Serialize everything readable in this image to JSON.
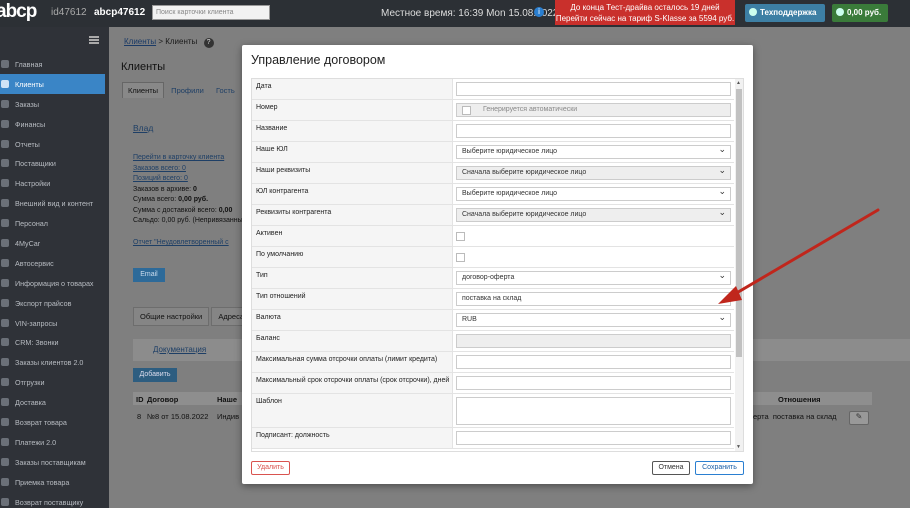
{
  "topbar": {
    "logo": "abcp",
    "account_id": "id47612",
    "account_login": "abcp47612",
    "search_placeholder": "Поиск карточки клиента",
    "local_time": "Местное время: 16:39 Mon 15.08.2022",
    "alert_line1": "До конца Тест-драйва осталось 19 дней",
    "alert_line2": "Перейти сейчас на тариф S-Klasse за 5594 руб.",
    "support_label": "Техподдержка",
    "balance_label": "0,00 руб."
  },
  "sidebar": {
    "items": [
      {
        "label": "Главная"
      },
      {
        "label": "Клиенты"
      },
      {
        "label": "Заказы"
      },
      {
        "label": "Финансы"
      },
      {
        "label": "Отчеты"
      },
      {
        "label": "Поставщики"
      },
      {
        "label": "Настройки"
      },
      {
        "label": "Внешний вид и контент"
      },
      {
        "label": "Персонал"
      },
      {
        "label": "4MyCar"
      },
      {
        "label": "Автосервис"
      },
      {
        "label": "Информация о товарах"
      },
      {
        "label": "Экспорт прайсов"
      },
      {
        "label": "VIN-запросы"
      },
      {
        "label": "CRM: Звонки"
      },
      {
        "label": "Заказы клиентов 2.0"
      },
      {
        "label": "Отгрузки"
      },
      {
        "label": "Доставка"
      },
      {
        "label": "Возврат товара"
      },
      {
        "label": "Платежи 2.0"
      },
      {
        "label": "Заказы поставщикам"
      },
      {
        "label": "Приемка товара"
      },
      {
        "label": "Возврат поставщику"
      }
    ],
    "active_index": 1
  },
  "page": {
    "breadcrumb_link": "Клиенты",
    "breadcrumb_sep": ">",
    "breadcrumb_current": "Клиенты",
    "title": "Клиенты",
    "tabs": [
      "Клиенты",
      "Профили",
      "Гость"
    ],
    "client_name": "Влад",
    "client_card_link": "Перейти в карточку клиента",
    "orders_total": "Заказов всего: 0",
    "positions_total": "Позиций всего: 0",
    "orders_archive_label": "Заказов в архиве: ",
    "orders_archive_value": "0",
    "sum_total_label": "Сумма всего: ",
    "sum_total_value": "0,00 руб.",
    "sum_delivery_label": "Сумма с доставкой всего: ",
    "sum_delivery_value": "0,00",
    "saldo": "Сальдо: 0,00 руб. (Непривязанны",
    "report_link": "Отчет \"Неудовлетворенный с",
    "email_button": "Email",
    "subtabs": [
      "Общие настройки",
      "Адреса д"
    ],
    "docs_header": "Документация",
    "add_button": "Добавить",
    "table_headers": [
      "ID",
      "Договор",
      "Наше"
    ],
    "table_row": [
      "8",
      "№8 от 15.08.2022",
      "Индив"
    ],
    "right_headers": [
      "Отношения"
    ],
    "right_row": [
      "ерта",
      "поставка на склад"
    ]
  },
  "modal": {
    "title": "Управление договором",
    "rows": [
      {
        "label": "Дата",
        "type": "input",
        "value": ""
      },
      {
        "label": "Номер",
        "type": "autogen",
        "value": "Генерируется автоматически"
      },
      {
        "label": "Название",
        "type": "input",
        "value": ""
      },
      {
        "label": "Наше ЮЛ",
        "type": "select",
        "value": "Выберите юридическое лицо"
      },
      {
        "label": "Наши реквизиты",
        "type": "select-disabled",
        "value": "Сначала выберите юридическое лицо"
      },
      {
        "label": "ЮЛ контрагента",
        "type": "select",
        "value": "Выберите юридическое лицо"
      },
      {
        "label": "Реквизиты контрагента",
        "type": "select-disabled",
        "value": "Сначала выберите юридическое лицо"
      },
      {
        "label": "Активен",
        "type": "checkbox",
        "value": ""
      },
      {
        "label": "По умолчанию",
        "type": "checkbox",
        "value": ""
      },
      {
        "label": "Тип",
        "type": "select",
        "value": "договор-оферта"
      },
      {
        "label": "Тип отношений",
        "type": "input",
        "value": "поставка на склад"
      },
      {
        "label": "Валюта",
        "type": "select",
        "value": "RUB"
      },
      {
        "label": "Баланс",
        "type": "disabled",
        "value": ""
      },
      {
        "label": "Максимальная сумма отсрочки оплаты (лимит кредита)",
        "type": "input",
        "value": ""
      },
      {
        "label": "Максимальный срок отсрочки оплаты (срок отсрочки), дней",
        "type": "input",
        "value": ""
      },
      {
        "label": "Шаблон",
        "type": "textarea",
        "value": ""
      },
      {
        "label": "Подписант: должность",
        "type": "input",
        "value": ""
      }
    ],
    "delete_button": "Удалить",
    "cancel_button": "Отмена",
    "save_button": "Сохранить"
  },
  "colors": {
    "sidebar_active": "#3a85c6",
    "alert_bg": "#c9302c",
    "arrow": "#c0261c"
  }
}
